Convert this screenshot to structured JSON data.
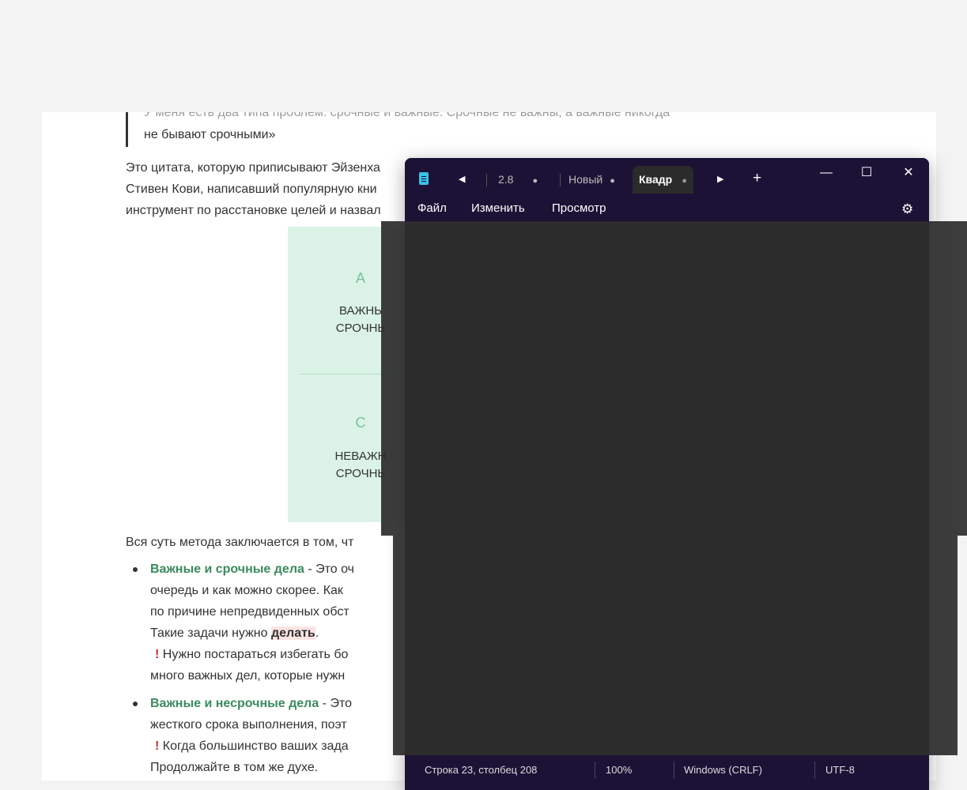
{
  "article": {
    "quote_cut": "У меня есть два типа проблем: срочные и важные. Срочные не важны, а важные никогда",
    "quote_end": "не бывают срочными»",
    "para1": [
      "Это цитата, которую приписывают Эйзенха",
      "Стивен Кови, написавший популярную кни",
      "инструмент по расстановке целей и назвал"
    ],
    "matrix": {
      "a_letter": "A",
      "a_line1": "ВАЖНЬ",
      "a_line2": "СРОЧНЬ",
      "c_letter": "C",
      "c_line1": "НЕВАЖН",
      "c_line2": "СРОЧНЬ"
    },
    "para2": "Вся суть метода заключается в том, чт",
    "bullet1": {
      "title": "Важные и срочные дела",
      "line1_rest": " - Это оч",
      "line2": "очередь и как можно скорее. Как",
      "line3": "по причине непредвиденных обст",
      "line4_pre": "Такие задачи нужно ",
      "line4_hl": "делать",
      "line4_post": ".",
      "warn_mark": "!",
      "line5": " Нужно постараться избегать бо",
      "line6": "много важных дел, которые нужн"
    },
    "bullet2": {
      "title": "Важные и несрочные дела",
      "line1_rest": " - Это",
      "line2": "жесткого срока выполнения, поэт",
      "warn_mark": "!",
      "line3": " Когда большинство ваших зада",
      "line4": "Продолжайте в том же духе."
    }
  },
  "notepad": {
    "tabs": [
      {
        "label": "2.8",
        "modified": "●"
      },
      {
        "label": "Новый",
        "modified": "●"
      },
      {
        "label": "Квадр",
        "modified": "●",
        "active": true
      }
    ],
    "nav_prev": "◀",
    "nav_next": "▶",
    "new_tab": "+",
    "minimize": "—",
    "maximize": "☐",
    "close": "✕",
    "menu": [
      "Файл",
      "Изменить",
      "Просмотр"
    ],
    "status": {
      "position": "Строка 23, столбец 208",
      "zoom": "100%",
      "line_endings": "Windows (CRLF)",
      "encoding": "UTF-8"
    }
  },
  "colors": {
    "accent_green": "#3a8c5c",
    "matrix_bg": "#dbf3e6",
    "highlight": "#fde4e4",
    "notepad_chrome": "#1c1236"
  }
}
